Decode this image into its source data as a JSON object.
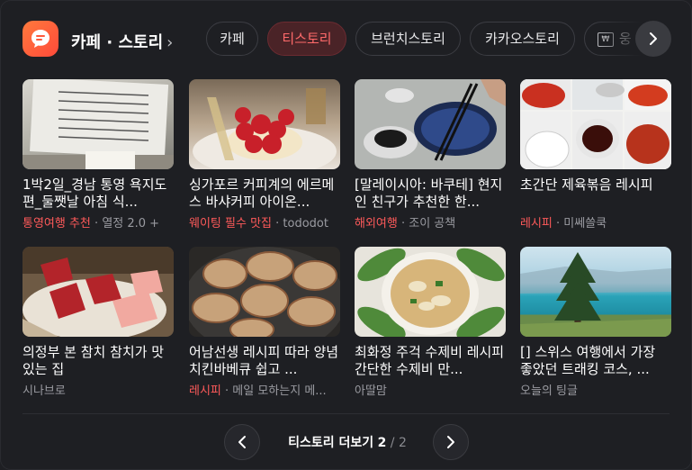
{
  "header": {
    "title": "카페 · 스토리",
    "tabs": [
      {
        "label": "카페",
        "active": false
      },
      {
        "label": "티스토리",
        "active": true
      },
      {
        "label": "브런치스토리",
        "active": false
      },
      {
        "label": "카카오스토리",
        "active": false
      },
      {
        "label": "웅",
        "active": false
      }
    ]
  },
  "cards": [
    {
      "title": "1박2일_경남 통영 욕지도 편_둘쨋날 아침 식...",
      "tag": "통영여행 추천",
      "source": "열정 2.0 +"
    },
    {
      "title": "싱가포르 커피계의 에르메스 바샤커피 아이온...",
      "tag": "웨이팅 필수 맛집",
      "source": "tododot"
    },
    {
      "title": "[말레이시아: 바쿠테] 현지인 친구가 추천한 한...",
      "tag": "해외여행",
      "source": "조이 공책"
    },
    {
      "title": "초간단 제육볶음 레시피",
      "tag": "레시피",
      "source": "미쎄쓸쿡"
    },
    {
      "title": "의정부 본 참치 참치가 맛있는 집",
      "tag": "",
      "source": "시나브로"
    },
    {
      "title": "어남선생 레시피 따라 양념치킨바베큐 쉽고 ...",
      "tag": "레시피",
      "source": "메일 모하는지 메..."
    },
    {
      "title": "최화정 주걱 수제비 레시피 간단한 수제비 만...",
      "tag": "",
      "source": "아딸맘"
    },
    {
      "title": "[] 스위스 여행에서 가장 좋았던 트래킹 코스, ...",
      "tag": "",
      "source": "오늘의 팅글"
    }
  ],
  "pager": {
    "label": "티스토리 더보기",
    "current": "2",
    "separator": "/",
    "total": "2"
  }
}
